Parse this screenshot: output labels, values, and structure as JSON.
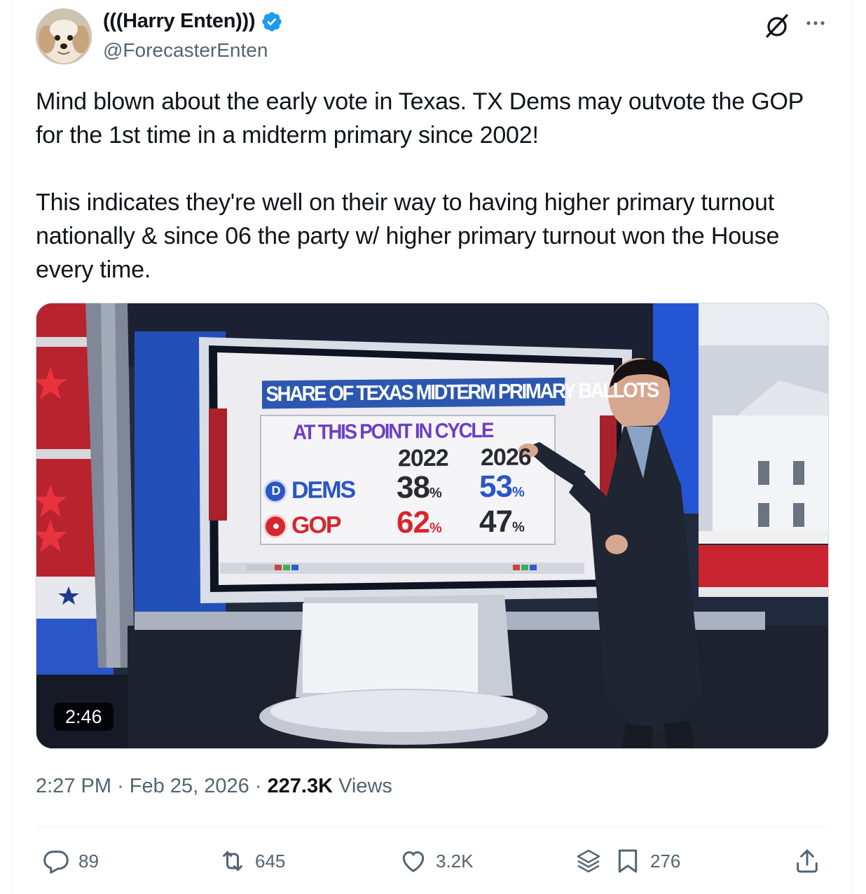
{
  "author": {
    "display_name": "(((Harry Enten)))",
    "handle": "@ForecasterEnten",
    "verified": true
  },
  "tweet": {
    "paragraph_1": "Mind blown about the early vote in Texas. TX Dems may outvote the GOP for the 1st time in a midterm primary since 2002!",
    "paragraph_2": "This indicates they're well on their way to having higher primary turnout nationally & since 06 the party w/ higher primary turnout won the House every time."
  },
  "media": {
    "duration": "2:46",
    "screen": {
      "title": "SHARE OF TEXAS MIDTERM PRIMARY BALLOTS",
      "subtitle": "AT THIS POINT IN CYCLE",
      "year_1": "2022",
      "year_2": "2026",
      "dems_label": "DEMS",
      "gop_label": "GOP",
      "dems_badge": "D",
      "dems_2022": "38",
      "dems_2026": "53",
      "gop_2022": "62",
      "gop_2026": "47",
      "pct_sign": "%"
    }
  },
  "meta": {
    "time": "2:27 PM",
    "separator": "·",
    "date": "Feb 25, 2026",
    "views_count": "227.3K",
    "views_label": "Views"
  },
  "actions": {
    "replies": "89",
    "reposts": "645",
    "likes": "3.2K",
    "bookmarks": "276"
  },
  "colors": {
    "verified_blue": "#1d9bf0",
    "secondary_text": "#536471",
    "dems_blue": "#2b55c7",
    "gop_red": "#d7262e",
    "subtitle_purple": "#6d3fc4"
  }
}
